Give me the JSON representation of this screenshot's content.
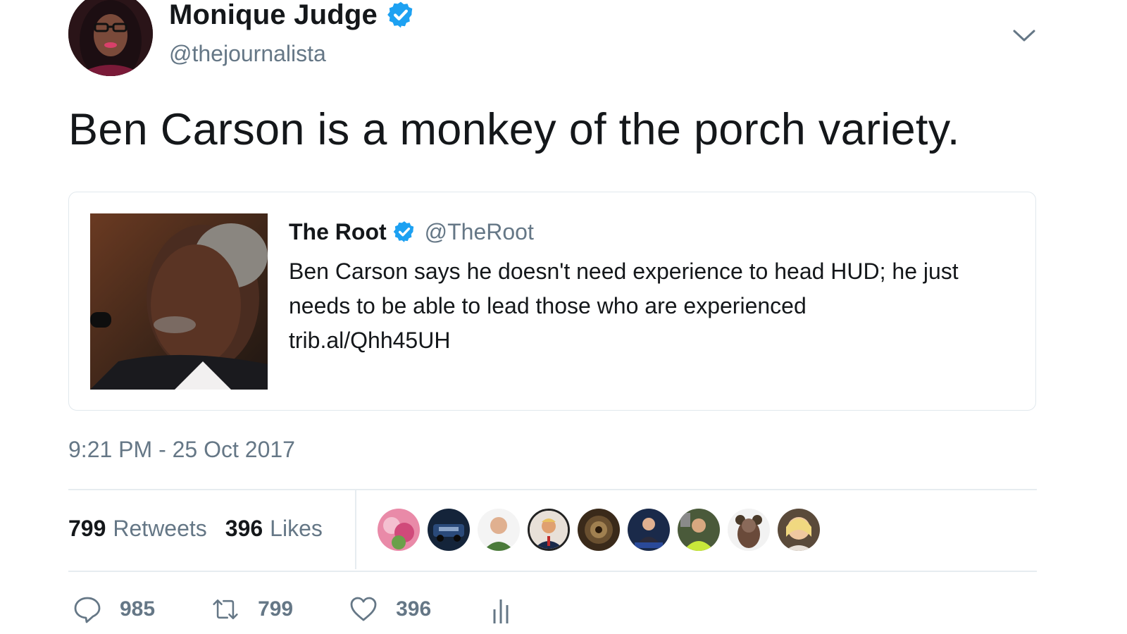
{
  "author": {
    "display_name": "Monique Judge",
    "handle": "@thejournalista",
    "verified": true
  },
  "tweet": {
    "text": "Ben Carson is a monkey of the porch variety.",
    "timestamp": "9:21 PM - 25 Oct 2017"
  },
  "quoted_tweet": {
    "display_name": "The Root",
    "handle": "@TheRoot",
    "verified": true,
    "text_lines": [
      "Ben Carson says he doesn't need experience to head HUD; he just",
      "needs to be able to lead those who are experienced",
      "trib.al/Qhh45UH"
    ]
  },
  "stats": {
    "retweets_count": "799",
    "retweets_label": "Retweets",
    "likes_count": "396",
    "likes_label": "Likes"
  },
  "actions": {
    "reply_count": "985",
    "retweet_count": "799",
    "like_count": "396"
  },
  "icons": {
    "verified": "verified-badge-icon",
    "caret": "chevron-down-icon",
    "reply": "reply-icon",
    "retweet": "retweet-icon",
    "like": "heart-icon",
    "analytics": "analytics-icon"
  },
  "colors": {
    "verified_blue": "#1da1f2",
    "secondary_text": "#657786",
    "primary_text": "#14171a",
    "border": "#e1e8ed"
  }
}
